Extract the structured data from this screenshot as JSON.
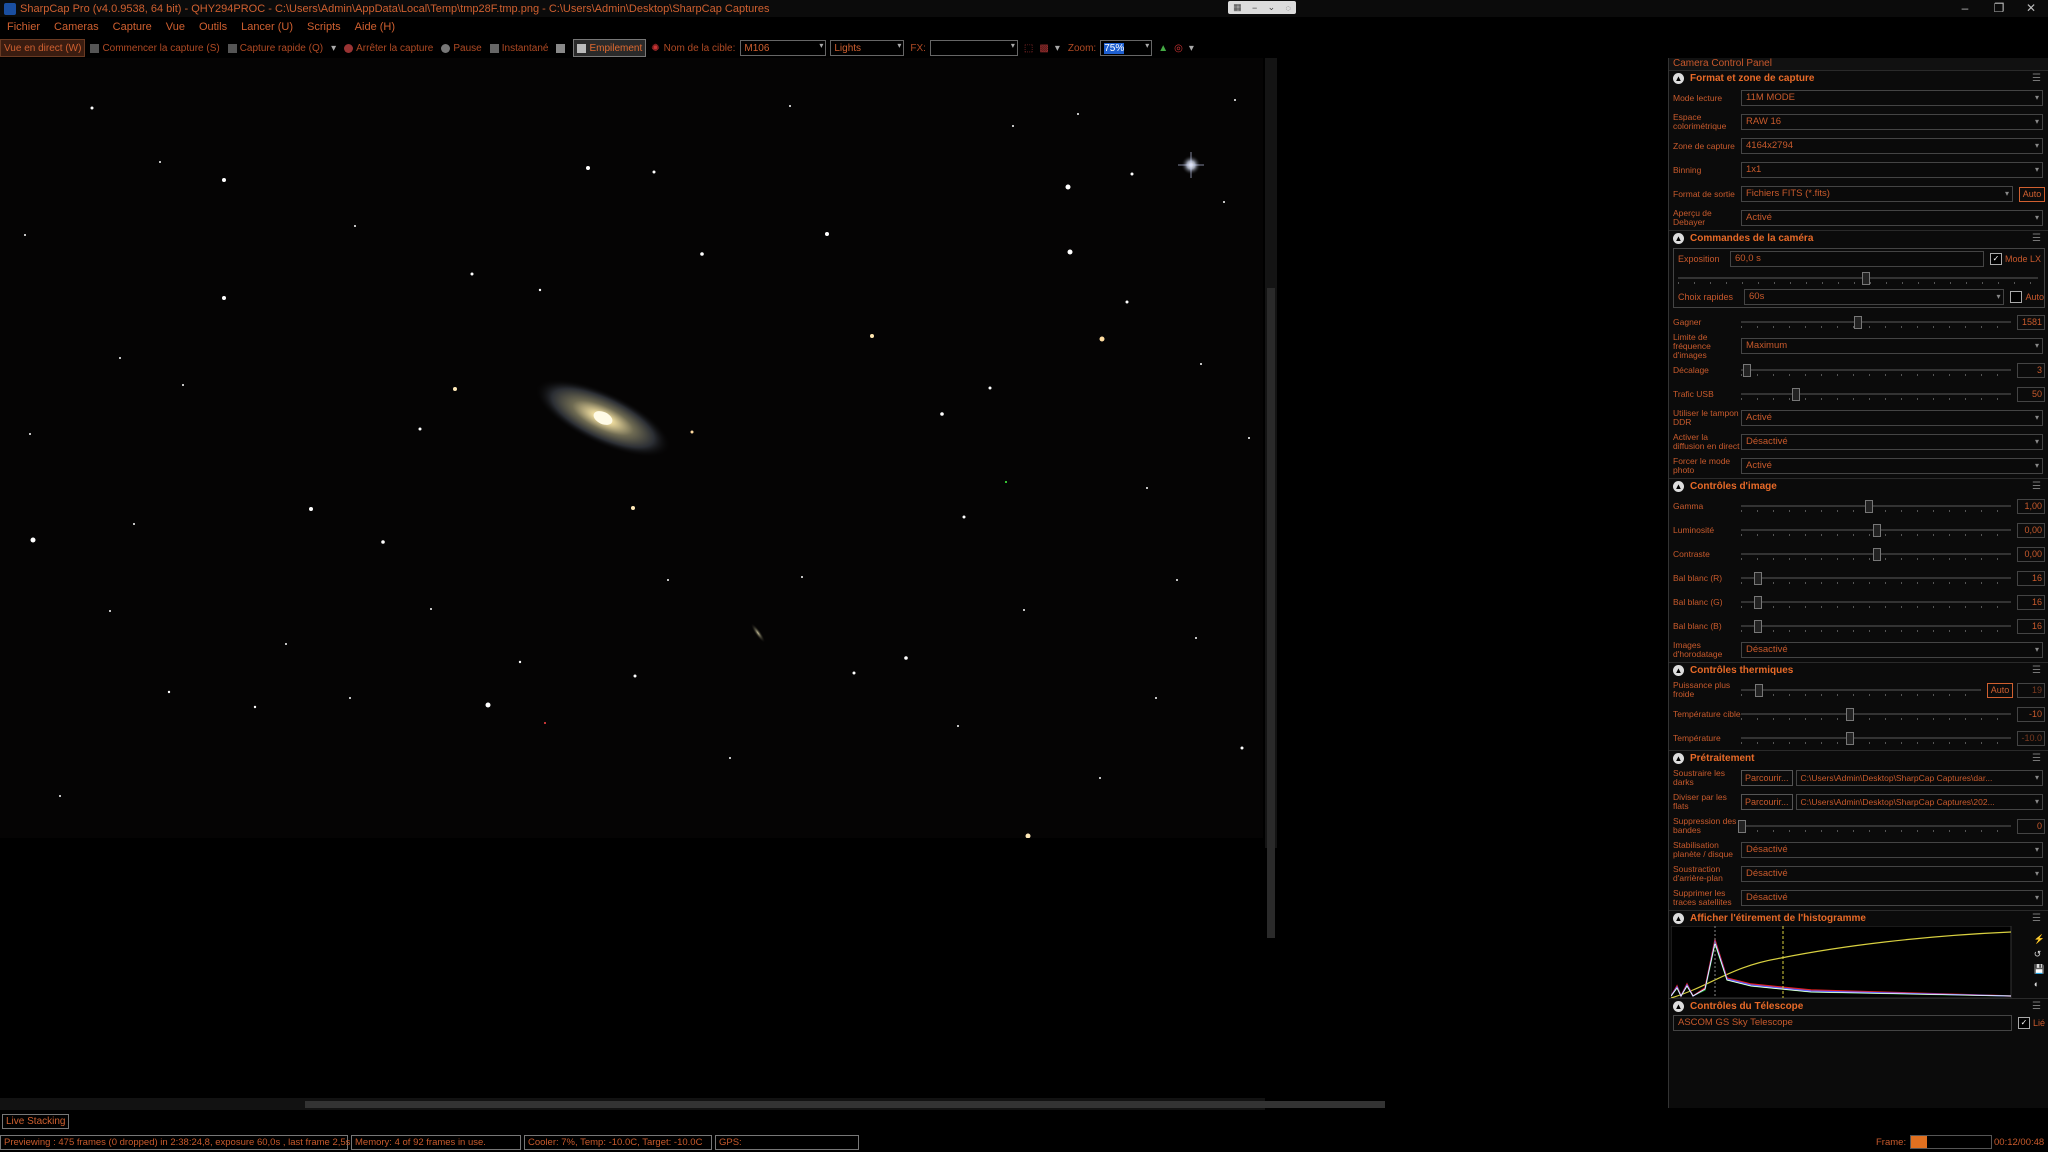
{
  "window": {
    "title": "SharpCap Pro (v4.0.9538, 64 bit) - QHY294PROC - C:\\Users\\Admin\\AppData\\Local\\Temp\\tmp28F.tmp.png - C:\\Users\\Admin\\Desktop\\SharpCap Captures",
    "minimize": "‒",
    "restore": "❐",
    "close": "✕"
  },
  "menu": [
    "Fichier",
    "Cameras",
    "Capture",
    "Vue",
    "Outils",
    "Lancer (U)",
    "Scripts",
    "Aide (H)"
  ],
  "toolbar": {
    "live_view": "Vue en direct (W)",
    "start_capture": "Commencer la capture (S)",
    "quick_capture": "Capture rapide (Q)",
    "stop_capture": "Arrêter la capture",
    "pause": "Pause",
    "snapshot": "Instantané",
    "stacking": "Empilement",
    "target_label": "Nom de la cible:",
    "target_value": "M106",
    "frame_type": "Lights",
    "fx_label": "FX:",
    "fx_value": "",
    "zoom_label": "Zoom:",
    "zoom_value": "75%"
  },
  "panel": {
    "title": "Camera Control Panel",
    "format": {
      "header": "Format et zone de capture",
      "rows": [
        {
          "label": "Mode lecture",
          "value": "11M MODE"
        },
        {
          "label": "Espace colorimétrique",
          "value": "RAW 16"
        },
        {
          "label": "Zone de capture",
          "value": "4164x2794"
        },
        {
          "label": "Binning",
          "value": "1x1"
        },
        {
          "label": "Format de sortie",
          "value": "Fichiers FITS (*.fits)",
          "auto": "Auto"
        },
        {
          "label": "Aperçu de Debayer",
          "value": "Activé"
        }
      ]
    },
    "camera": {
      "header": "Commandes de la caméra",
      "exposure_label": "Exposition",
      "exposure_value": "60,0 s",
      "lx_label": "Mode LX",
      "exposure_slider": 0.52,
      "quick_choice_label": "Choix rapides",
      "quick_choice_value": "60s",
      "quick_auto": "Auto",
      "gain": {
        "label": "Gagner",
        "value": "1581",
        "level": 0.43
      },
      "fps_limit": {
        "label": "Limite de fréquence d'images",
        "value": "Maximum"
      },
      "offset": {
        "label": "Décalage",
        "value": "3",
        "level": 0.02
      },
      "usb": {
        "label": "Trafic USB",
        "value": "50",
        "level": 0.2
      },
      "ddr": {
        "label": "Utiliser le tampon DDR",
        "value": "Activé"
      },
      "live_stream": {
        "label": "Activer la diffusion en direct",
        "value": "Désactivé"
      },
      "photo_mode": {
        "label": "Forcer le mode photo",
        "value": "Activé"
      }
    },
    "image": {
      "header": "Contrôles d'image",
      "sliders": [
        {
          "label": "Gamma",
          "value": "1,00",
          "level": 0.47
        },
        {
          "label": "Luminosité",
          "value": "0,00",
          "level": 0.5
        },
        {
          "label": "Contraste",
          "value": "0,00",
          "level": 0.5
        },
        {
          "label": "Bal blanc (R)",
          "value": "16",
          "level": 0.06
        },
        {
          "label": "Bal blanc (G)",
          "value": "16",
          "level": 0.06
        },
        {
          "label": "Bal blanc (B)",
          "value": "16",
          "level": 0.06
        }
      ],
      "timestamp": {
        "label": "Images d'horodatage",
        "value": "Désactivé"
      }
    },
    "thermal": {
      "header": "Contrôles thermiques",
      "power": {
        "label": "Puissance plus froide",
        "auto": "Auto",
        "value": "19",
        "level": 0.07
      },
      "target": {
        "label": "Température cible",
        "value": "-10",
        "level": 0.4
      },
      "temp": {
        "label": "Température",
        "value": "-10.0",
        "level": 0.4
      }
    },
    "preprocessing": {
      "header": "Prétraitement",
      "darks": {
        "label": "Soustraire les darks",
        "button": "Parcourir...",
        "value": "C:\\Users\\Admin\\Desktop\\SharpCap Captures\\dar..."
      },
      "flats": {
        "label": "Diviser par les flats",
        "button": "Parcourir...",
        "value": "C:\\Users\\Admin\\Desktop\\SharpCap Captures\\202..."
      },
      "banding": {
        "label": "Suppression des bandes",
        "value": "0",
        "level": 0.0
      },
      "stabilization": {
        "label": "Stabilisation planète / disque",
        "value": "Désactivé"
      },
      "background": {
        "label": "Soustraction d'arrière-plan",
        "value": "Désactivé"
      },
      "satellite": {
        "label": "Supprimer les traces satellites",
        "value": "Désactivé"
      }
    },
    "histogram": {
      "header": "Afficher l'étirement de l'histogramme"
    },
    "telescope": {
      "header": "Contrôles du Télescope",
      "value": "ASCOM GS Sky Telescope",
      "linked": "Lié"
    }
  },
  "live_stacking": "Live Stacking",
  "status": {
    "preview": "Previewing : 475 frames (0 dropped) in 2:38:24,8, exposure 60,0s , last frame 2,5s",
    "memory": "Memory: 4 of 92 frames in use.",
    "cooler": "Cooler: 7%, Temp: -10.0C, Target: -10.0C",
    "gps": "GPS:",
    "frame_label": "Frame:",
    "frame_progress": 0.2,
    "time": "00:12/00:48"
  }
}
